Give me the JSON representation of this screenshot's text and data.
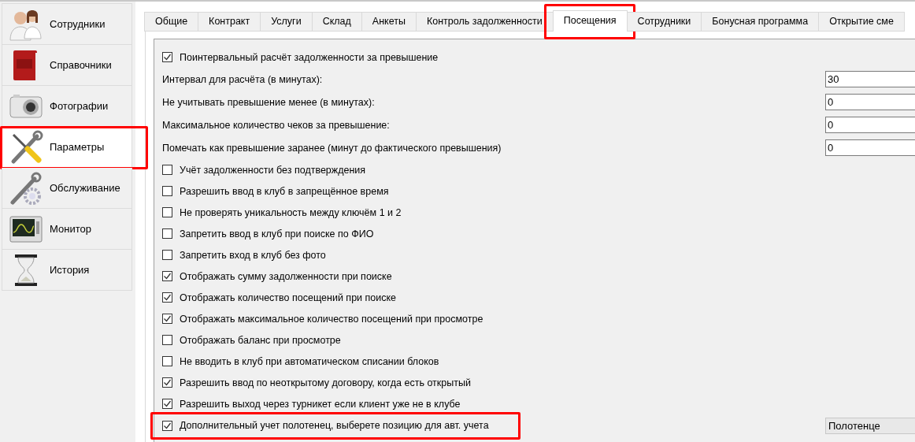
{
  "sidebar": {
    "items": [
      {
        "label": "Сотрудники",
        "selected": false,
        "highlighted": false
      },
      {
        "label": "Справочники",
        "selected": false,
        "highlighted": false
      },
      {
        "label": "Фотографии",
        "selected": false,
        "highlighted": false
      },
      {
        "label": "Параметры",
        "selected": true,
        "highlighted": true
      },
      {
        "label": "Обслуживание",
        "selected": false,
        "highlighted": false
      },
      {
        "label": "Монитор",
        "selected": false,
        "highlighted": false
      },
      {
        "label": "История",
        "selected": false,
        "highlighted": false
      }
    ]
  },
  "tabs": [
    {
      "label": "Общие",
      "selected": false,
      "highlighted": false
    },
    {
      "label": "Контракт",
      "selected": false,
      "highlighted": false
    },
    {
      "label": "Услуги",
      "selected": false,
      "highlighted": false
    },
    {
      "label": "Склад",
      "selected": false,
      "highlighted": false
    },
    {
      "label": "Анкеты",
      "selected": false,
      "highlighted": false
    },
    {
      "label": "Контроль задолженности",
      "selected": false,
      "highlighted": false
    },
    {
      "label": "Посещения",
      "selected": true,
      "highlighted": true
    },
    {
      "label": "Сотрудники",
      "selected": false,
      "highlighted": false
    },
    {
      "label": "Бонусная программа",
      "selected": false,
      "highlighted": false
    },
    {
      "label": "Открытие сме",
      "selected": false,
      "highlighted": false
    }
  ],
  "settings": [
    {
      "kind": "checkbox",
      "label": "Поинтервальный расчёт задолженности за превышение",
      "checked": true,
      "highlighted": false
    },
    {
      "kind": "field",
      "label": "Интервал для расчёта (в минутах):",
      "value": "30",
      "highlighted": false
    },
    {
      "kind": "field",
      "label": "Не учитывать превышение менее (в минутах):",
      "value": "0",
      "highlighted": false
    },
    {
      "kind": "field",
      "label": "Максимальное количество чеков за превышение:",
      "value": "0",
      "highlighted": false
    },
    {
      "kind": "field",
      "label": "Помечать как превышение заранее (минут до фактического превышения)",
      "value": "0",
      "highlighted": false
    },
    {
      "kind": "checkbox",
      "label": "Учёт задолженности без подтверждения",
      "checked": false,
      "highlighted": false
    },
    {
      "kind": "checkbox",
      "label": "Разрешить ввод в клуб в запрещённое время",
      "checked": false,
      "highlighted": false
    },
    {
      "kind": "checkbox",
      "label": "Не проверять уникальность между ключём 1 и 2",
      "checked": false,
      "highlighted": false
    },
    {
      "kind": "checkbox",
      "label": "Запретить ввод в клуб при поиске по ФИО",
      "checked": false,
      "highlighted": false
    },
    {
      "kind": "checkbox",
      "label": "Запретить вход в клуб без фото",
      "checked": false,
      "highlighted": false
    },
    {
      "kind": "checkbox",
      "label": "Отображать сумму задолженности при поиске",
      "checked": true,
      "highlighted": false
    },
    {
      "kind": "checkbox",
      "label": "Отображать количество посещений при поиске",
      "checked": true,
      "highlighted": false
    },
    {
      "kind": "checkbox",
      "label": "Отображать максимальное количество посещений при просмотре",
      "checked": true,
      "highlighted": false
    },
    {
      "kind": "checkbox",
      "label": "Отображать баланс при просмотре",
      "checked": false,
      "highlighted": false
    },
    {
      "kind": "checkbox",
      "label": "Не вводить в клуб при автоматическом списании блоков",
      "checked": false,
      "highlighted": false
    },
    {
      "kind": "checkbox",
      "label": "Разрешить ввод по неоткрытому договору, когда есть открытый",
      "checked": true,
      "highlighted": false
    },
    {
      "kind": "checkbox",
      "label": "Разрешить выход через турникет если клиент уже не в клубе",
      "checked": true,
      "highlighted": false
    },
    {
      "kind": "select",
      "label": "Дополнительный учет полотенец, выберете позицию для авт. учета",
      "checked": true,
      "value": "Полотенце",
      "highlighted": true
    }
  ]
}
